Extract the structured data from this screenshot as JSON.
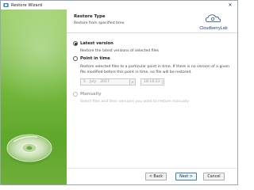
{
  "window": {
    "title": "Restore Wizard",
    "close_glyph": "✕"
  },
  "header": {
    "title": "Restore Type",
    "subtitle": "Restore from specified time",
    "logo_text": "CloudberryLab"
  },
  "options": [
    {
      "label": "Latest version",
      "description": "Restore the latest versions of selected files",
      "selected": true,
      "enabled": true
    },
    {
      "label": "Point in time",
      "description": "Restore selected files to a particular point in time. If there is no version of a given file modified before this point in time, no file will be restored.",
      "selected": false,
      "enabled": true
    },
    {
      "label": "Manually",
      "description": "Select files and their versions you want to restore manually",
      "selected": false,
      "enabled": false
    }
  ],
  "point_in_time": {
    "day": "5",
    "month": "July",
    "year": "2017",
    "time": "18:16:23"
  },
  "buttons": {
    "back": "< Back",
    "next": "Next >",
    "cancel": "Cancel"
  },
  "colors": {
    "side_panel": "#73b63c",
    "logo": "#1d3e78",
    "primary_border": "#3c7fb1"
  },
  "icons": [
    "wizard-app-icon",
    "close-icon",
    "cloudberry-logo-icon",
    "disc-icon",
    "calendar-icon",
    "spin-icon"
  ]
}
